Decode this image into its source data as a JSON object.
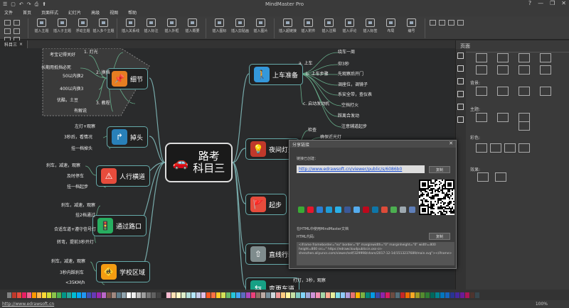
{
  "window": {
    "title": "MindMaster Pro",
    "quick_access": [
      "☰",
      "▢",
      "↶",
      "↷",
      "⎙",
      "⬆"
    ],
    "win_controls": [
      "?",
      "—",
      "❐",
      "✕"
    ]
  },
  "menu": [
    "文件",
    "首页",
    "页面样式",
    "幻灯片",
    "高级",
    "视图",
    "帮助"
  ],
  "ribbon": [
    {
      "btns": []
    },
    {
      "btns": [
        "插入主题",
        "插入子主题",
        "浮动主题",
        "插入多个主题"
      ]
    },
    {
      "btns": [
        "插入关系线",
        "插入标注",
        "插入外框",
        "插入概要"
      ]
    },
    {
      "btns": [
        "插入图标",
        "插入剪贴画",
        "插入图片"
      ]
    },
    {
      "btns": [
        "插入超链接",
        "插入附件",
        "插入注释",
        "插入评论",
        "插入标签",
        "布局",
        "编号"
      ]
    }
  ],
  "tab": {
    "label": "科目三",
    "close": "×"
  },
  "central": {
    "line1": "路考",
    "line2": "科目三"
  },
  "topics": [
    {
      "id": "detail",
      "label": "细节",
      "icon": "pin"
    },
    {
      "id": "turn",
      "label": "掉头",
      "icon": "uturn"
    },
    {
      "id": "crosswalk",
      "label": "人行横道",
      "icon": "warning"
    },
    {
      "id": "intersection",
      "label": "通过路口",
      "icon": "traffic-light"
    },
    {
      "id": "school",
      "label": "学校区域",
      "icon": "school"
    },
    {
      "id": "ready",
      "label": "上车准备",
      "icon": "person"
    },
    {
      "id": "night",
      "label": "夜间灯光",
      "icon": "lamp"
    },
    {
      "id": "start",
      "label": "起步",
      "icon": "flag"
    },
    {
      "id": "straight",
      "label": "直线行驶",
      "icon": "road"
    },
    {
      "id": "lane",
      "label": "变更车道",
      "icon": "lane"
    }
  ],
  "sub_texts": {
    "detail": [
      "1. 灯光",
      "考宝记得关好",
      "长期用抵挡必死",
      "2. 换挡",
      "50以内换2",
      "400以内换3",
      "优酷，土豆",
      "3. 教程",
      "有解说"
    ],
    "turn": [
      "左灯+观察",
      "3秒后，看情况",
      "挂一档掉头"
    ],
    "crosswalk": [
      "刹车，减速，观察",
      "及时停车",
      "挂一档起步"
    ],
    "intersection": [
      "刹车，减速，观察",
      "挂2档通过",
      "合适车道+遵守信号灯",
      "转弯，提前3秒开灯"
    ],
    "school": [
      "刹车，减速，观察",
      "3秒内踩刹车",
      "<35KM/h"
    ],
    "ready": [
      "绕车一周",
      "仰3秒",
      "a. 上车",
      "先观察后开门",
      "b. 上车步骤",
      "调座位，调镜子",
      "系安全带，查仪表",
      "c. 启动发动机",
      "空挡打火",
      "踩离合发动",
      "注意辅道起步"
    ],
    "night": [
      "检查",
      "确保近光灯",
      "近光"
    ],
    "lane": [
      "打灯，3秒，观察"
    ]
  },
  "right_panel": {
    "title": "页面",
    "labels": {
      "background": "背景:",
      "theme": "主题:",
      "color": "彩色:",
      "effect": "效果:"
    }
  },
  "dialog": {
    "title": "分享链接",
    "close": "✕",
    "link_label": "链接已创建：",
    "link": "http://www.edrawsoft.cn/viewer/public/s/6086b0",
    "copy": "复制",
    "embed_label": "在HTML中使用MindMaster文档",
    "code_label": "HTML代码:",
    "code": "<iframe frameborder=\"no\" border=\"0\" marginwidth=\"0\" marginheight=\"0\" width=800 height=800 src=\" https://edrawcloudpubliccn.oss-cn-shenzhen.aliyuncs.com/viewer/self/329998/share/2017-12-14/1513237689/main.svg\"></iframe>",
    "social_colors": [
      "#3aaa35",
      "#e6162d",
      "#2a7fd4",
      "#1e9cd7",
      "#2ab0e8",
      "#3b5998",
      "#55acee",
      "#bd081c",
      "#0e76a8",
      "#dd4b39",
      "#4caf50",
      "#9ea9b0",
      "#5f7fb9"
    ]
  },
  "palette_colors": [
    "#7f7f7f",
    "#c0392b",
    "#e74c3c",
    "#e91e63",
    "#f06292",
    "#ff9800",
    "#ffb74d",
    "#fdd835",
    "#cddc39",
    "#8bc34a",
    "#4caf50",
    "#009688",
    "#26a69a",
    "#00bcd4",
    "#03a9f4",
    "#2196f3",
    "#3f51b5",
    "#673ab7",
    "#9c27b0",
    "#ba68c8",
    "#795548",
    "#a1887f",
    "#607d8b",
    "#90a4ae",
    "#ffffff",
    "#eeeeee",
    "#bdbdbd",
    "#9e9e9e",
    "#757575",
    "#616161",
    "#424242",
    "#212121",
    "#f8bbd0",
    "#ffe0b2",
    "#fff9c4",
    "#dcedc8",
    "#b2dfdb",
    "#b3e5fc",
    "#c5cae9",
    "#e1bee7",
    "#ff5722",
    "#ff7043",
    "#ffca28",
    "#d4e157",
    "#66bb6a",
    "#26c6da",
    "#42a5f5",
    "#5c6bc0",
    "#ab47bc",
    "#ec407a",
    "#8d6e63",
    "#bcaaa4",
    "#78909c",
    "#cfd8dc",
    "#ef9a9a",
    "#ffcc80",
    "#fff59d",
    "#c5e1a5",
    "#80cbc4",
    "#81d4fa",
    "#9fa8da",
    "#ce93d8",
    "#f48fb1",
    "#a5d6a7",
    "#ffab91",
    "#e6ee9c",
    "#80deea",
    "#90caf9",
    "#b39ddb",
    "#e57373",
    "#ffb300",
    "#7cb342",
    "#00897b",
    "#039be5",
    "#3949ab",
    "#8e24aa",
    "#d81b60",
    "#6d4c41",
    "#546e7a",
    "#c62828",
    "#ef6c00",
    "#f9a825",
    "#9e9d24",
    "#558b2f",
    "#2e7d32",
    "#00695c",
    "#00838f",
    "#0277bd",
    "#1565c0",
    "#283593",
    "#4527a0",
    "#6a1b9a",
    "#ad1457",
    "#4e342e",
    "#37474f"
  ],
  "status": {
    "url": "http://www.edrawsoft.cn",
    "zoom": "100%"
  }
}
